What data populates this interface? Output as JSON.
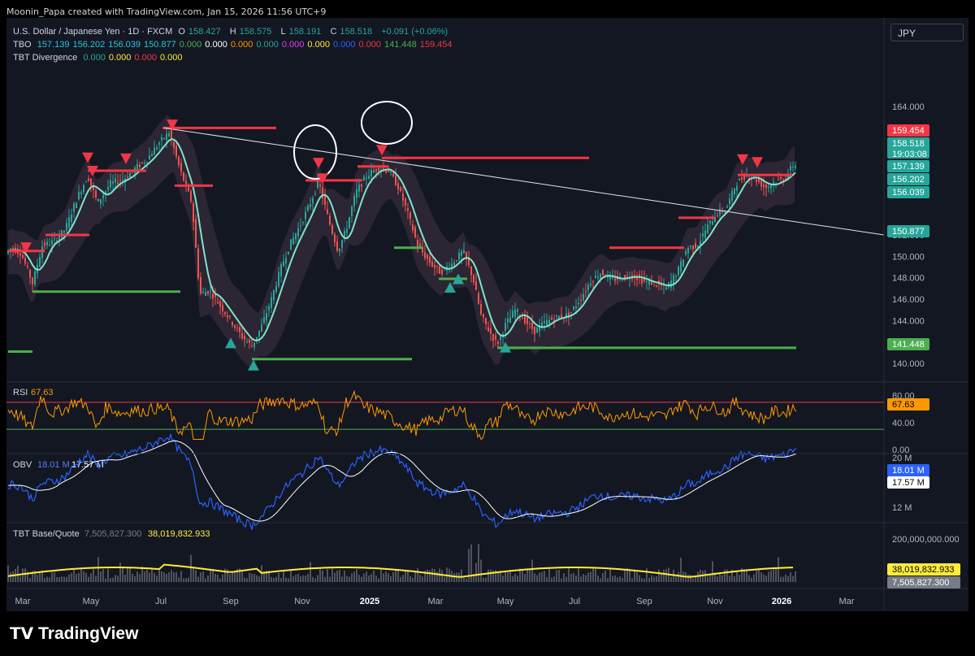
{
  "header": {
    "attribution": "Moonin_Papa created with TradingView.com, Jan 15, 2026 11:56 UTC+9"
  },
  "legend": {
    "symbol": "U.S. Dollar / Japanese Yen · 1D · FXCM",
    "o_label": "O",
    "o": "158.427",
    "h_label": "H",
    "h": "158.575",
    "l_label": "L",
    "l": "158.191",
    "c_label": "C",
    "c": "158.518",
    "chg": "+0.091 (+0.06%)",
    "tbo_name": "TBO",
    "tbo_values": [
      {
        "v": "157.139",
        "color": "#26c6da"
      },
      {
        "v": "156.202",
        "color": "#26c6da"
      },
      {
        "v": "156.039",
        "color": "#26c6da"
      },
      {
        "v": "150.877",
        "color": "#26c6da"
      },
      {
        "v": "0.000",
        "color": "#4caf50"
      },
      {
        "v": "0.000",
        "color": "#ffffff"
      },
      {
        "v": "0.000",
        "color": "#ff9800"
      },
      {
        "v": "0.000",
        "color": "#26a69a"
      },
      {
        "v": "0.000",
        "color": "#e040fb"
      },
      {
        "v": "0.000",
        "color": "#ffeb3b"
      },
      {
        "v": "0.000",
        "color": "#2962ff"
      },
      {
        "v": "0.000",
        "color": "#f23645"
      },
      {
        "v": "141.448",
        "color": "#4caf50"
      },
      {
        "v": "159.454",
        "color": "#f23645"
      }
    ],
    "div_name": "TBT Divergence",
    "div_values": [
      {
        "v": "0.000",
        "color": "#26a69a"
      },
      {
        "v": "0.000",
        "color": "#ffeb3b"
      },
      {
        "v": "0.000",
        "color": "#f23645"
      },
      {
        "v": "0.000",
        "color": "#ffeb3b"
      }
    ]
  },
  "currency": "JPY",
  "colors": {
    "bg": "#131722",
    "up": "#26a69a",
    "down": "#ef5350",
    "red_line": "#f23645",
    "green_line": "#4caf50",
    "ma_fast": "#7fe3c9",
    "ma_fast_down": "#f48fb1",
    "rsi": "#ff9800",
    "obv": "#2962ff",
    "obv_ma": "#ffffff",
    "vol_ma": "#ffeb3b",
    "grid": "#1e222d"
  },
  "chart_data": [
    {
      "type": "line",
      "title": "U.S. Dollar / Japanese Yen · 1D · FXCM",
      "ylim": [
        139.0,
        166.0
      ],
      "yticks": [
        "164.000",
        "152.000",
        "150.000",
        "148.000",
        "146.000",
        "144.000",
        "142.000",
        "140.000"
      ],
      "ytick_values": [
        164,
        152,
        150,
        148,
        146,
        144,
        142,
        140
      ],
      "xticks": [
        "Mar",
        "May",
        "Jul",
        "Sep",
        "Nov",
        "2025",
        "Mar",
        "May",
        "Jul",
        "Sep",
        "Nov",
        "2026",
        "Mar"
      ],
      "price_path": [
        [
          0,
          149.8
        ],
        [
          14,
          150.8
        ],
        [
          26,
          150.3
        ],
        [
          40,
          147.5
        ],
        [
          52,
          151.0
        ],
        [
          66,
          151.4
        ],
        [
          80,
          152.5
        ],
        [
          95,
          155.5
        ],
        [
          108,
          157.5
        ],
        [
          120,
          155.0
        ],
        [
          136,
          156.8
        ],
        [
          152,
          157.2
        ],
        [
          166,
          158.2
        ],
        [
          180,
          159.0
        ],
        [
          196,
          160.6
        ],
        [
          208,
          161.6
        ],
        [
          222,
          158.0
        ],
        [
          236,
          155.0
        ],
        [
          246,
          146.5
        ],
        [
          258,
          146.8
        ],
        [
          270,
          145.5
        ],
        [
          284,
          144.0
        ],
        [
          298,
          142.5
        ],
        [
          310,
          141.6
        ],
        [
          322,
          143.5
        ],
        [
          334,
          146.0
        ],
        [
          346,
          149.0
        ],
        [
          358,
          151.3
        ],
        [
          370,
          153.0
        ],
        [
          382,
          155.0
        ],
        [
          392,
          157.0
        ],
        [
          404,
          153.5
        ],
        [
          416,
          150.5
        ],
        [
          426,
          152.5
        ],
        [
          438,
          156.0
        ],
        [
          452,
          157.6
        ],
        [
          466,
          158.3
        ],
        [
          478,
          158.0
        ],
        [
          490,
          156.5
        ],
        [
          502,
          154.0
        ],
        [
          514,
          151.0
        ],
        [
          528,
          149.5
        ],
        [
          542,
          148.5
        ],
        [
          556,
          149.3
        ],
        [
          570,
          150.5
        ],
        [
          582,
          148.0
        ],
        [
          592,
          144.5
        ],
        [
          602,
          143.0
        ],
        [
          612,
          141.8
        ],
        [
          622,
          143.6
        ],
        [
          634,
          145.0
        ],
        [
          646,
          144.0
        ],
        [
          658,
          143.0
        ],
        [
          670,
          143.8
        ],
        [
          684,
          144.3
        ],
        [
          700,
          144.5
        ],
        [
          714,
          146.0
        ],
        [
          728,
          147.8
        ],
        [
          740,
          148.5
        ],
        [
          752,
          147.8
        ],
        [
          766,
          148.0
        ],
        [
          780,
          148.2
        ],
        [
          794,
          147.6
        ],
        [
          806,
          147.5
        ],
        [
          820,
          147.0
        ],
        [
          834,
          148.6
        ],
        [
          846,
          150.8
        ],
        [
          858,
          151.0
        ],
        [
          870,
          152.7
        ],
        [
          882,
          154.0
        ],
        [
          894,
          154.5
        ],
        [
          906,
          156.8
        ],
        [
          918,
          157.6
        ],
        [
          930,
          157.2
        ],
        [
          942,
          156.4
        ],
        [
          954,
          157.0
        ],
        [
          966,
          157.3
        ],
        [
          976,
          158.5
        ],
        [
          980,
          158.5
        ]
      ],
      "series": [
        {
          "name": "TBO",
          "values": [
            157.139,
            156.202,
            156.039,
            150.877
          ]
        }
      ],
      "red_levels": [
        {
          "x0": 10,
          "x1": 55,
          "y": 150.5
        },
        {
          "x0": 108,
          "x1": 180,
          "y": 158.0
        },
        {
          "x0": 200,
          "x1": 340,
          "y": 162.0
        },
        {
          "x0": 215,
          "x1": 262,
          "y": 156.6
        },
        {
          "x0": 376,
          "x1": 446,
          "y": 157.1
        },
        {
          "x0": 440,
          "x1": 478,
          "y": 158.4
        },
        {
          "x0": 470,
          "x1": 725,
          "y": 159.2
        },
        {
          "x0": 56,
          "x1": 110,
          "y": 152.0
        },
        {
          "x0": 750,
          "x1": 842,
          "y": 150.8
        },
        {
          "x0": 908,
          "x1": 975,
          "y": 157.6
        },
        {
          "x0": 835,
          "x1": 880,
          "y": 153.6
        }
      ],
      "green_levels": [
        {
          "x0": 40,
          "x1": 222,
          "y": 146.7
        },
        {
          "x0": 10,
          "x1": 40,
          "y": 141.1
        },
        {
          "x0": 310,
          "x1": 507,
          "y": 140.4
        },
        {
          "x0": 612,
          "x1": 980,
          "y": 141.448
        },
        {
          "x0": 485,
          "x1": 520,
          "y": 150.8
        },
        {
          "x0": 540,
          "x1": 575,
          "y": 147.9
        }
      ],
      "trendline": {
        "from": [
          202,
          162.0
        ],
        "to": [
          1088,
          152.0
        ]
      },
      "last_marks": [
        "159.454",
        "158.518",
        "157.139",
        "156.202",
        "156.039",
        "150.877",
        "141.448"
      ],
      "countdown": "19:03:08",
      "sell_signals_x": [
        32,
        108,
        114,
        155,
        212,
        392,
        397,
        470,
        914,
        932
      ],
      "buy_signals_x": [
        284,
        312,
        554,
        564,
        622
      ]
    },
    {
      "type": "line",
      "title": "RSI",
      "value": "67.63",
      "ylim": [
        0,
        100
      ],
      "yticks": [
        "80.00",
        "40.00",
        "0.00"
      ],
      "ytick_values": [
        80,
        40,
        0
      ],
      "upper_band": 70,
      "lower_band": 30
    },
    {
      "type": "line",
      "title": "OBV",
      "values_shown": [
        "18.01 M",
        "17.57 M"
      ],
      "yticks": [
        "20 M",
        "12 M"
      ]
    },
    {
      "type": "bar",
      "title": "TBT Base/Quote",
      "values_shown": [
        "7,505,827.300",
        "38,019,832.933"
      ],
      "yticks": [
        "200,000,000.000"
      ]
    }
  ],
  "footer": {
    "brand": "TradingView"
  }
}
